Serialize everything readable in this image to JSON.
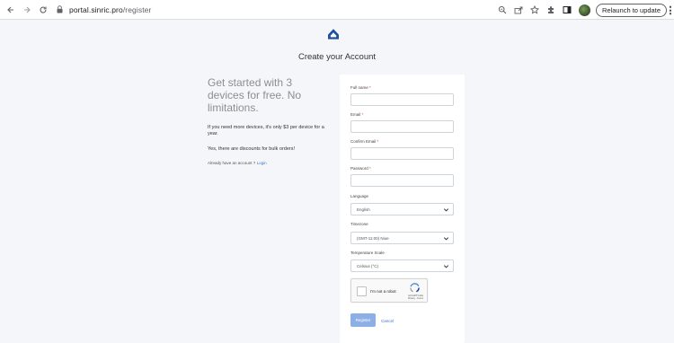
{
  "browser": {
    "url_domain": "portal.sinric.pro",
    "url_path": "/register",
    "relaunch_label": "Relaunch to update"
  },
  "page": {
    "title": "Create your Account"
  },
  "intro": {
    "headline": "Get started with 3 devices for free. No limitations.",
    "more_devices": "If you need more devices, it's only $3 per device for a year.",
    "bulk": "Yes, there are discounts for bulk orders!",
    "already_text": "Already have an account ?",
    "login_link": "Login"
  },
  "form": {
    "fullname_label": "Full name",
    "email_label": "Email",
    "confirm_email_label": "Confirm Email",
    "password_label": "Password",
    "required_mark": "*",
    "language_label": "Language",
    "language_value": "English",
    "timezone_label": "Timezone",
    "timezone_value": "(GMT-11:00) Niue",
    "temp_label": "Temperature Scale",
    "temp_value": "Celsius (°C)",
    "captcha_text": "I'm not a robot",
    "captcha_brand": "reCAPTCHA",
    "captcha_links": "Privacy - Terms",
    "register_label": "Register",
    "cancel_label": "Cancel"
  },
  "colors": {
    "accent": "#3d76d1",
    "logo": "#1f4f9c",
    "button": "#8cb0e6",
    "background": "#f4f6f9"
  }
}
